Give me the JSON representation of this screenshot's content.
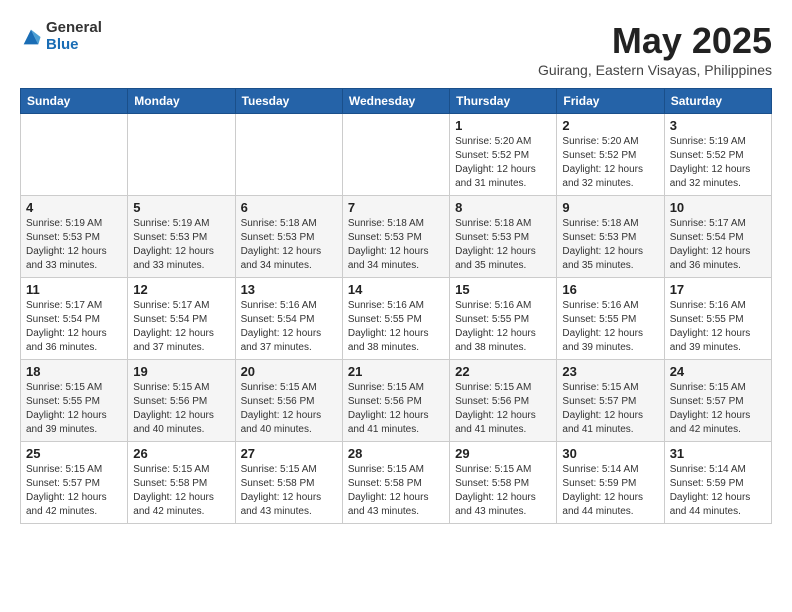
{
  "header": {
    "logo": {
      "general": "General",
      "blue": "Blue"
    },
    "title": "May 2025",
    "subtitle": "Guirang, Eastern Visayas, Philippines"
  },
  "calendar": {
    "headers": [
      "Sunday",
      "Monday",
      "Tuesday",
      "Wednesday",
      "Thursday",
      "Friday",
      "Saturday"
    ],
    "rows": [
      [
        {
          "day": "",
          "info": ""
        },
        {
          "day": "",
          "info": ""
        },
        {
          "day": "",
          "info": ""
        },
        {
          "day": "",
          "info": ""
        },
        {
          "day": "1",
          "info": "Sunrise: 5:20 AM\nSunset: 5:52 PM\nDaylight: 12 hours\nand 31 minutes."
        },
        {
          "day": "2",
          "info": "Sunrise: 5:20 AM\nSunset: 5:52 PM\nDaylight: 12 hours\nand 32 minutes."
        },
        {
          "day": "3",
          "info": "Sunrise: 5:19 AM\nSunset: 5:52 PM\nDaylight: 12 hours\nand 32 minutes."
        }
      ],
      [
        {
          "day": "4",
          "info": "Sunrise: 5:19 AM\nSunset: 5:53 PM\nDaylight: 12 hours\nand 33 minutes."
        },
        {
          "day": "5",
          "info": "Sunrise: 5:19 AM\nSunset: 5:53 PM\nDaylight: 12 hours\nand 33 minutes."
        },
        {
          "day": "6",
          "info": "Sunrise: 5:18 AM\nSunset: 5:53 PM\nDaylight: 12 hours\nand 34 minutes."
        },
        {
          "day": "7",
          "info": "Sunrise: 5:18 AM\nSunset: 5:53 PM\nDaylight: 12 hours\nand 34 minutes."
        },
        {
          "day": "8",
          "info": "Sunrise: 5:18 AM\nSunset: 5:53 PM\nDaylight: 12 hours\nand 35 minutes."
        },
        {
          "day": "9",
          "info": "Sunrise: 5:18 AM\nSunset: 5:53 PM\nDaylight: 12 hours\nand 35 minutes."
        },
        {
          "day": "10",
          "info": "Sunrise: 5:17 AM\nSunset: 5:54 PM\nDaylight: 12 hours\nand 36 minutes."
        }
      ],
      [
        {
          "day": "11",
          "info": "Sunrise: 5:17 AM\nSunset: 5:54 PM\nDaylight: 12 hours\nand 36 minutes."
        },
        {
          "day": "12",
          "info": "Sunrise: 5:17 AM\nSunset: 5:54 PM\nDaylight: 12 hours\nand 37 minutes."
        },
        {
          "day": "13",
          "info": "Sunrise: 5:16 AM\nSunset: 5:54 PM\nDaylight: 12 hours\nand 37 minutes."
        },
        {
          "day": "14",
          "info": "Sunrise: 5:16 AM\nSunset: 5:55 PM\nDaylight: 12 hours\nand 38 minutes."
        },
        {
          "day": "15",
          "info": "Sunrise: 5:16 AM\nSunset: 5:55 PM\nDaylight: 12 hours\nand 38 minutes."
        },
        {
          "day": "16",
          "info": "Sunrise: 5:16 AM\nSunset: 5:55 PM\nDaylight: 12 hours\nand 39 minutes."
        },
        {
          "day": "17",
          "info": "Sunrise: 5:16 AM\nSunset: 5:55 PM\nDaylight: 12 hours\nand 39 minutes."
        }
      ],
      [
        {
          "day": "18",
          "info": "Sunrise: 5:15 AM\nSunset: 5:55 PM\nDaylight: 12 hours\nand 39 minutes."
        },
        {
          "day": "19",
          "info": "Sunrise: 5:15 AM\nSunset: 5:56 PM\nDaylight: 12 hours\nand 40 minutes."
        },
        {
          "day": "20",
          "info": "Sunrise: 5:15 AM\nSunset: 5:56 PM\nDaylight: 12 hours\nand 40 minutes."
        },
        {
          "day": "21",
          "info": "Sunrise: 5:15 AM\nSunset: 5:56 PM\nDaylight: 12 hours\nand 41 minutes."
        },
        {
          "day": "22",
          "info": "Sunrise: 5:15 AM\nSunset: 5:56 PM\nDaylight: 12 hours\nand 41 minutes."
        },
        {
          "day": "23",
          "info": "Sunrise: 5:15 AM\nSunset: 5:57 PM\nDaylight: 12 hours\nand 41 minutes."
        },
        {
          "day": "24",
          "info": "Sunrise: 5:15 AM\nSunset: 5:57 PM\nDaylight: 12 hours\nand 42 minutes."
        }
      ],
      [
        {
          "day": "25",
          "info": "Sunrise: 5:15 AM\nSunset: 5:57 PM\nDaylight: 12 hours\nand 42 minutes."
        },
        {
          "day": "26",
          "info": "Sunrise: 5:15 AM\nSunset: 5:58 PM\nDaylight: 12 hours\nand 42 minutes."
        },
        {
          "day": "27",
          "info": "Sunrise: 5:15 AM\nSunset: 5:58 PM\nDaylight: 12 hours\nand 43 minutes."
        },
        {
          "day": "28",
          "info": "Sunrise: 5:15 AM\nSunset: 5:58 PM\nDaylight: 12 hours\nand 43 minutes."
        },
        {
          "day": "29",
          "info": "Sunrise: 5:15 AM\nSunset: 5:58 PM\nDaylight: 12 hours\nand 43 minutes."
        },
        {
          "day": "30",
          "info": "Sunrise: 5:14 AM\nSunset: 5:59 PM\nDaylight: 12 hours\nand 44 minutes."
        },
        {
          "day": "31",
          "info": "Sunrise: 5:14 AM\nSunset: 5:59 PM\nDaylight: 12 hours\nand 44 minutes."
        }
      ]
    ]
  }
}
